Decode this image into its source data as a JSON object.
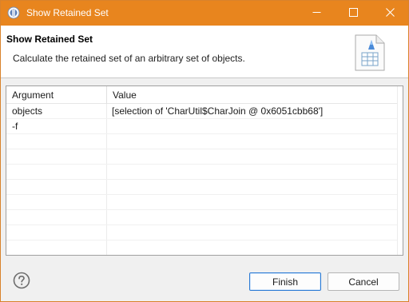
{
  "window": {
    "title": "Show Retained Set"
  },
  "header": {
    "title": "Show Retained Set",
    "description": "Calculate the retained set of an arbitrary set of objects."
  },
  "table": {
    "columns": [
      "Argument",
      "Value"
    ],
    "rows": [
      {
        "argument": "objects",
        "value": "[selection of 'CharUtil$CharJoin @ 0x6051cbb68']"
      },
      {
        "argument": "-f",
        "value": ""
      },
      {
        "argument": "",
        "value": ""
      },
      {
        "argument": "",
        "value": ""
      },
      {
        "argument": "",
        "value": ""
      },
      {
        "argument": "",
        "value": ""
      },
      {
        "argument": "",
        "value": ""
      },
      {
        "argument": "",
        "value": ""
      },
      {
        "argument": "",
        "value": ""
      },
      {
        "argument": "",
        "value": ""
      }
    ]
  },
  "buttons": {
    "finish": "Finish",
    "cancel": "Cancel"
  },
  "icons": {
    "app": "memory-analyzer-icon",
    "help": "help-icon",
    "minimize": "minimize-icon",
    "maximize": "maximize-icon",
    "close": "close-icon",
    "wizard": "query-wizard-icon"
  },
  "colors": {
    "titlebar": "#e8851e",
    "default_button_border": "#2a7ad5"
  }
}
